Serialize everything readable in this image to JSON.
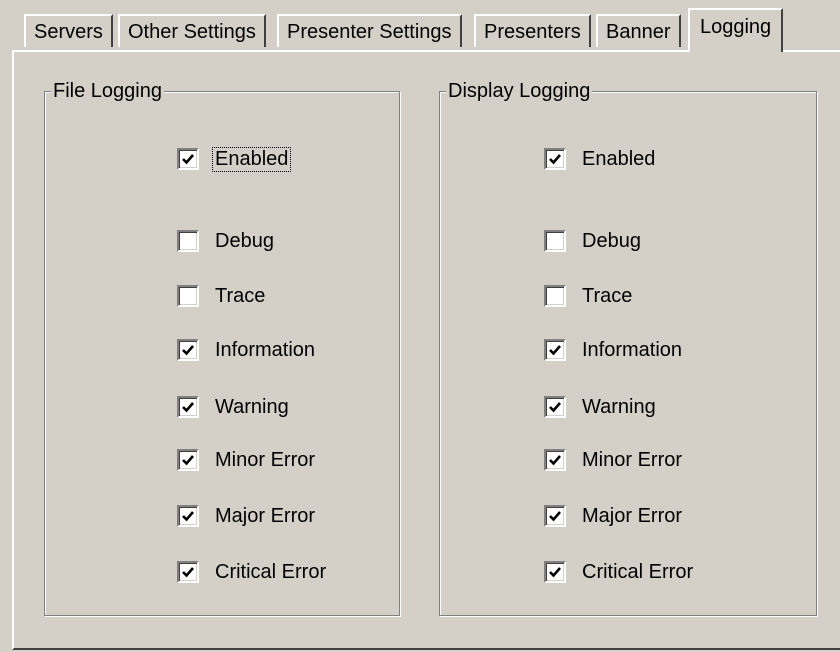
{
  "tabs": [
    {
      "label": "Servers",
      "active": false
    },
    {
      "label": "Other Settings",
      "active": false
    },
    {
      "label": "Presenter Settings",
      "active": false
    },
    {
      "label": "Presenters",
      "active": false
    },
    {
      "label": "Banner",
      "active": false
    },
    {
      "label": "Logging",
      "active": true
    }
  ],
  "file_logging": {
    "title": "File Logging",
    "enabled": {
      "label": "Enabled",
      "checked": true,
      "focused": true
    },
    "levels": [
      {
        "label": "Debug",
        "checked": false
      },
      {
        "label": "Trace",
        "checked": false
      },
      {
        "label": "Information",
        "checked": true
      },
      {
        "label": "Warning",
        "checked": true
      },
      {
        "label": "Minor Error",
        "checked": true
      },
      {
        "label": "Major Error",
        "checked": true
      },
      {
        "label": "Critical Error",
        "checked": true
      }
    ]
  },
  "display_logging": {
    "title": "Display Logging",
    "enabled": {
      "label": "Enabled",
      "checked": true,
      "focused": false
    },
    "levels": [
      {
        "label": "Debug",
        "checked": false
      },
      {
        "label": "Trace",
        "checked": false
      },
      {
        "label": "Information",
        "checked": true
      },
      {
        "label": "Warning",
        "checked": true
      },
      {
        "label": "Minor Error",
        "checked": true
      },
      {
        "label": "Major Error",
        "checked": true
      },
      {
        "label": "Critical Error",
        "checked": true
      }
    ]
  }
}
